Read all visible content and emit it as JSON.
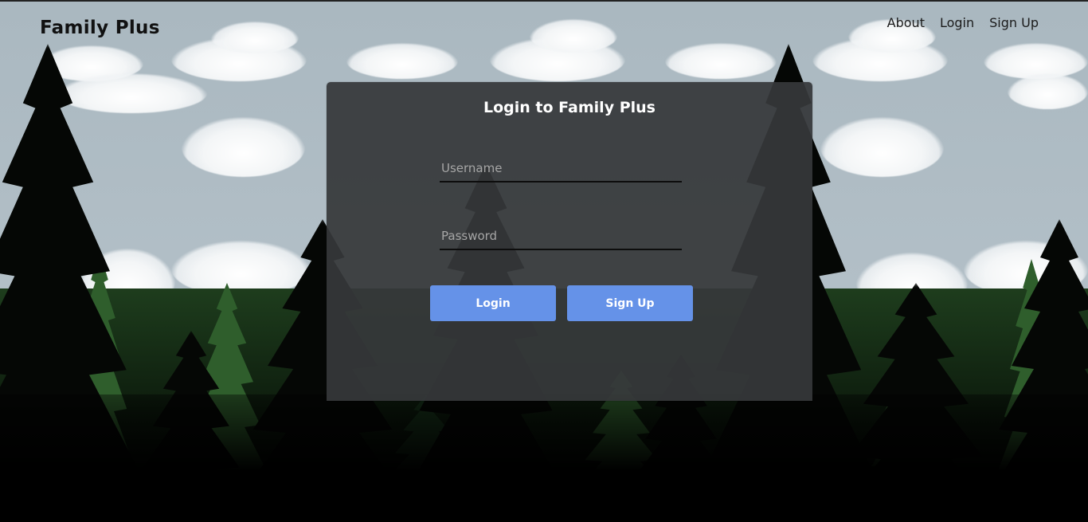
{
  "brand": {
    "name": "Family Plus"
  },
  "nav": {
    "items": [
      {
        "label": "About"
      },
      {
        "label": "Login"
      },
      {
        "label": "Sign Up"
      }
    ]
  },
  "login_card": {
    "title": "Login to Family Plus",
    "username_placeholder": "Username",
    "username_value": "",
    "password_placeholder": "Password",
    "password_value": "",
    "login_button": "Login",
    "signup_button": "Sign Up"
  },
  "colors": {
    "button": "#6592e8",
    "card_bg": "#36383a",
    "sky": "#afbcc4"
  },
  "background": {
    "description_icon": "forest-clouds-background"
  }
}
